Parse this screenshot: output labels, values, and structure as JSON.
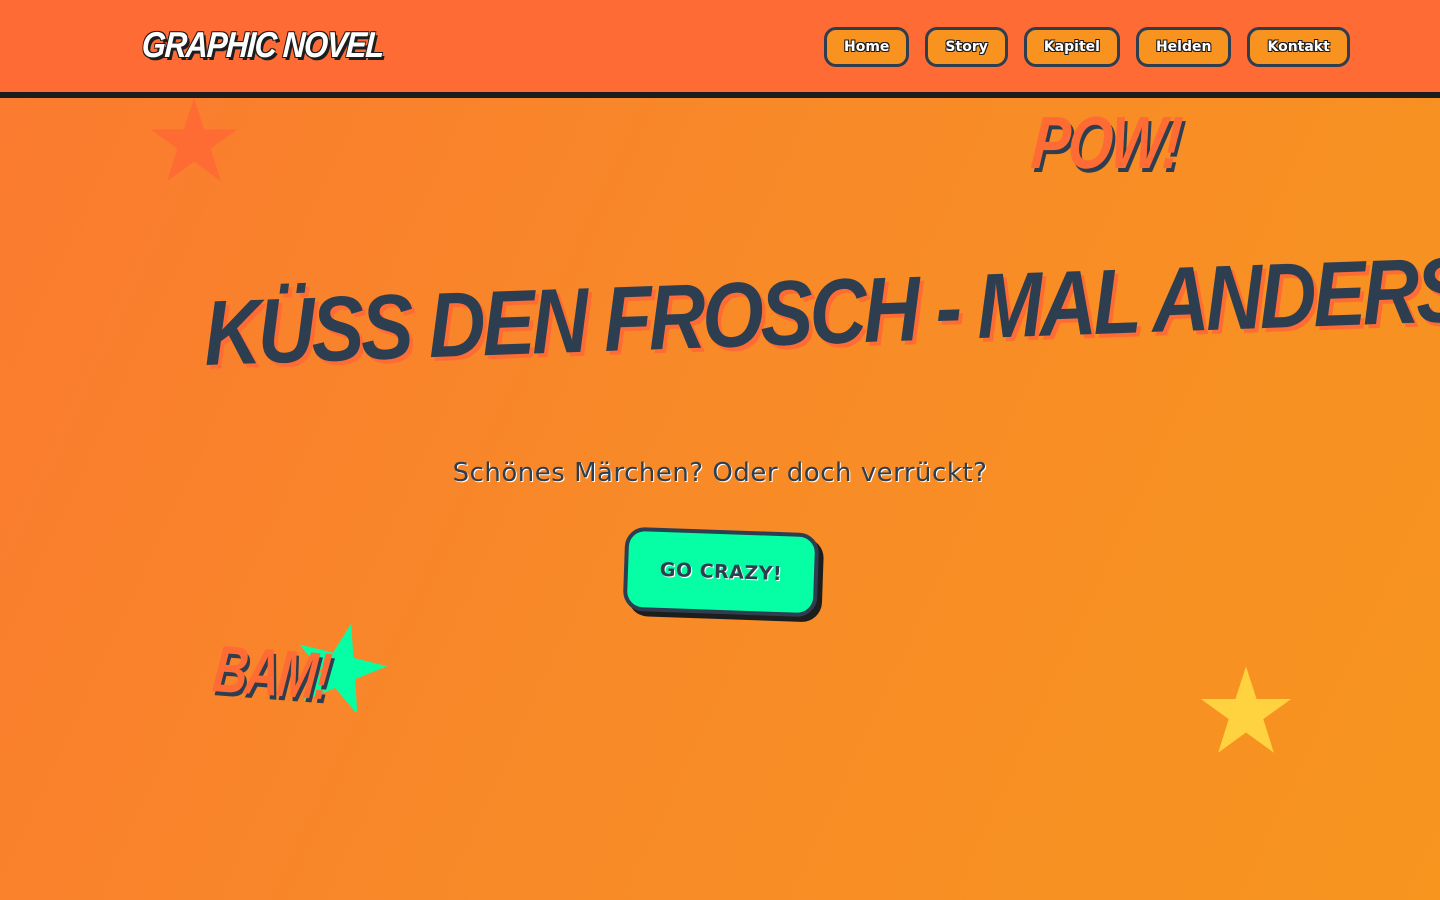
{
  "header": {
    "logo": "GRAPHIC NOVEL",
    "nav": [
      {
        "label": "Home"
      },
      {
        "label": "Story"
      },
      {
        "label": "Kapitel"
      },
      {
        "label": "Helden"
      },
      {
        "label": "Kontakt"
      }
    ]
  },
  "hero": {
    "title": "KÜSS DEN FROSCH - MAL ANDERS",
    "subtitle": "Schönes Märchen? Oder doch verrückt?",
    "cta_label": "GO CRAZY!"
  },
  "decorations": {
    "burst_top": "POW!",
    "burst_bottom": "BAM!",
    "stars": [
      {
        "icon": "star-icon",
        "color": "#ff6b35"
      },
      {
        "icon": "star-icon",
        "color": "#06ffa5"
      },
      {
        "icon": "star-icon",
        "color": "#ffd23f"
      }
    ]
  },
  "colors": {
    "accent_orange": "#ff6b35",
    "background": "#f7931e",
    "dark": "#2c3e50",
    "cta_green": "#06ffa5",
    "star_yellow": "#ffd23f"
  }
}
